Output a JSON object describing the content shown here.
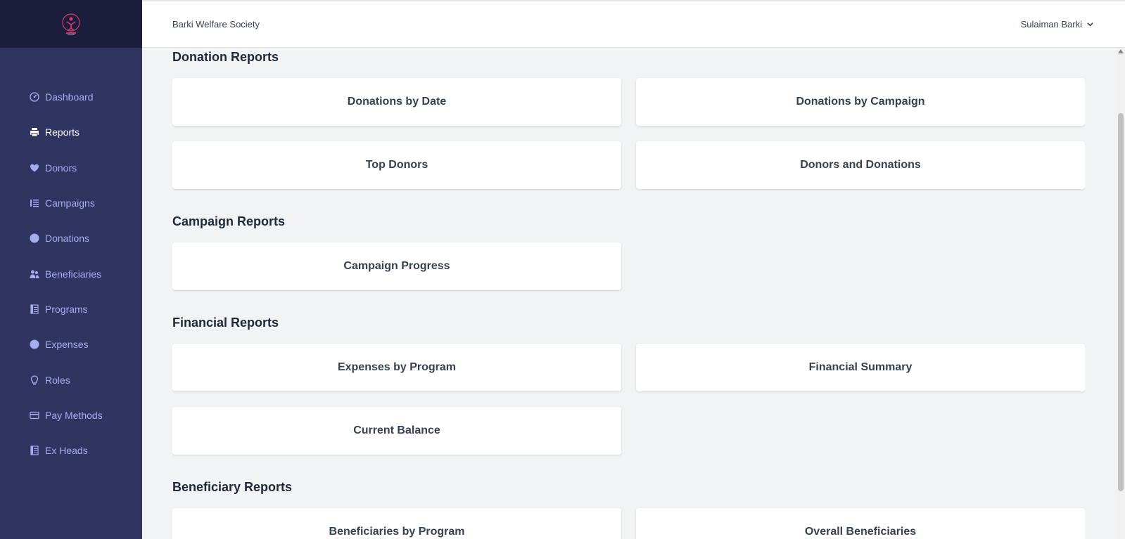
{
  "sidebar": {
    "items": [
      {
        "label": "Dashboard",
        "icon": "dashboard-icon"
      },
      {
        "label": "Reports",
        "icon": "printer-icon",
        "active": true
      },
      {
        "label": "Donors",
        "icon": "heart-icon"
      },
      {
        "label": "Campaigns",
        "icon": "list-icon"
      },
      {
        "label": "Donations",
        "icon": "circle-icon"
      },
      {
        "label": "Beneficiaries",
        "icon": "users-icon"
      },
      {
        "label": "Programs",
        "icon": "book-icon"
      },
      {
        "label": "Expenses",
        "icon": "circle-icon"
      },
      {
        "label": "Roles",
        "icon": "bulb-icon"
      },
      {
        "label": "Pay Methods",
        "icon": "card-icon"
      },
      {
        "label": "Ex Heads",
        "icon": "book-icon"
      }
    ]
  },
  "header": {
    "org_name": "Barki Welfare Society",
    "user_name": "Sulaiman Barki"
  },
  "sections": {
    "donation": {
      "title": "Donation Reports",
      "cards": [
        "Donations by Date",
        "Donations by Campaign",
        "Top Donors",
        "Donors and Donations"
      ]
    },
    "campaign": {
      "title": "Campaign Reports",
      "cards": [
        "Campaign Progress"
      ]
    },
    "financial": {
      "title": "Financial Reports",
      "cards": [
        "Expenses by Program",
        "Financial Summary",
        "Current Balance"
      ]
    },
    "beneficiary": {
      "title": "Beneficiary Reports",
      "cards": [
        "Beneficiaries by Program",
        "Overall Beneficiaries"
      ]
    }
  },
  "colors": {
    "sidebar_bg": "#2f3461",
    "logo_bg": "#1b1e3b",
    "nav_text": "#a7aef0",
    "accent": "#d63a6e"
  }
}
